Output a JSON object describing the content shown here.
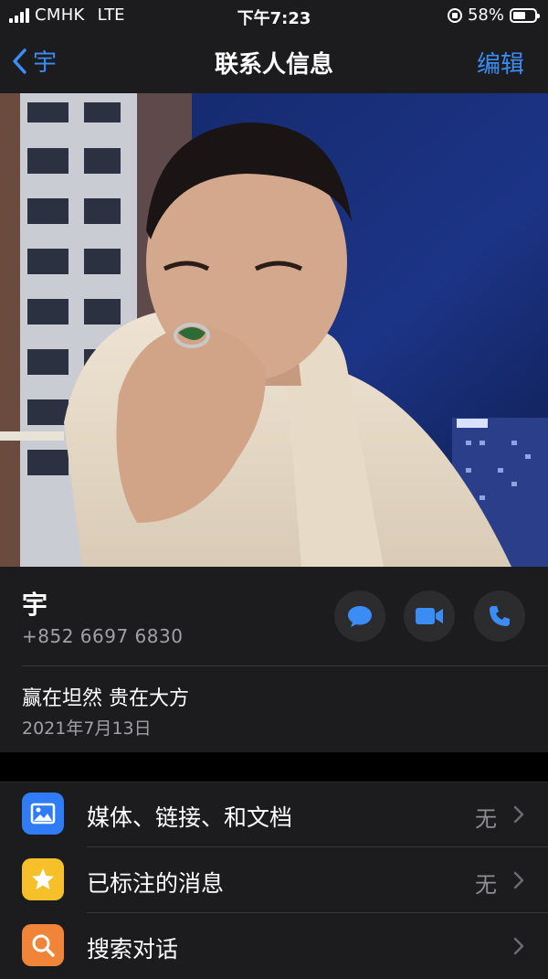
{
  "status_bar": {
    "carrier": "CMHK",
    "network": "LTE",
    "time": "下午7:23",
    "battery_percent": "58%",
    "battery_level": 0.58
  },
  "nav": {
    "back_label": "宇",
    "title": "联系人信息",
    "edit_label": "编辑"
  },
  "contact": {
    "name": "宇",
    "phone": "+852 6697 6830",
    "about": "赢在坦然 贵在大方",
    "about_date": "2021年7月13日"
  },
  "colors": {
    "accent": "#3b8df5",
    "media_icon_bg": "#2f7cf6",
    "starred_icon_bg": "#f5c02a",
    "search_icon_bg": "#f0853a"
  },
  "list": {
    "items": [
      {
        "label": "媒体、链接、和文档",
        "value": "无",
        "icon": "photo-icon"
      },
      {
        "label": "已标注的消息",
        "value": "无",
        "icon": "star-icon"
      },
      {
        "label": "搜索对话",
        "value": "",
        "icon": "search-icon"
      }
    ]
  }
}
